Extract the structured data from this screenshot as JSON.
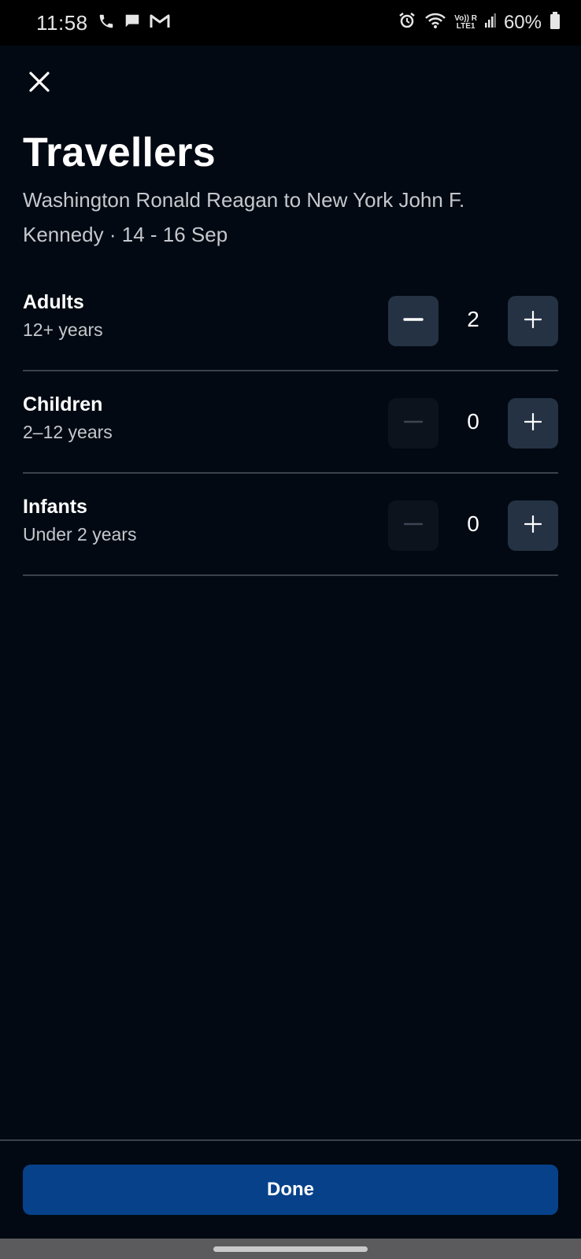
{
  "status_bar": {
    "time": "11:58",
    "battery": "60%",
    "network_label_top": "Vo)) R",
    "network_label_bottom": "LTE1",
    "icons": [
      "phone-icon",
      "chat-icon",
      "gmail-icon",
      "alarm-icon",
      "wifi-icon",
      "signal-icon",
      "battery-icon"
    ]
  },
  "header": {
    "close_icon": "close-icon",
    "title": "Travellers",
    "subtitle": "Washington Ronald Reagan to New York John F. Kennedy · 14 - 16 Sep"
  },
  "travellers": [
    {
      "label": "Adults",
      "sub": "12+ years",
      "count": "2",
      "minus_enabled": true
    },
    {
      "label": "Children",
      "sub": "2–12 years",
      "count": "0",
      "minus_enabled": false
    },
    {
      "label": "Infants",
      "sub": "Under 2 years",
      "count": "0",
      "minus_enabled": false
    }
  ],
  "footer": {
    "done_label": "Done"
  },
  "colors": {
    "background": "#020912",
    "stepper_active": "#243244",
    "stepper_disabled": "#0c131d",
    "primary_button": "#06418a",
    "divider": "#3a414b"
  }
}
